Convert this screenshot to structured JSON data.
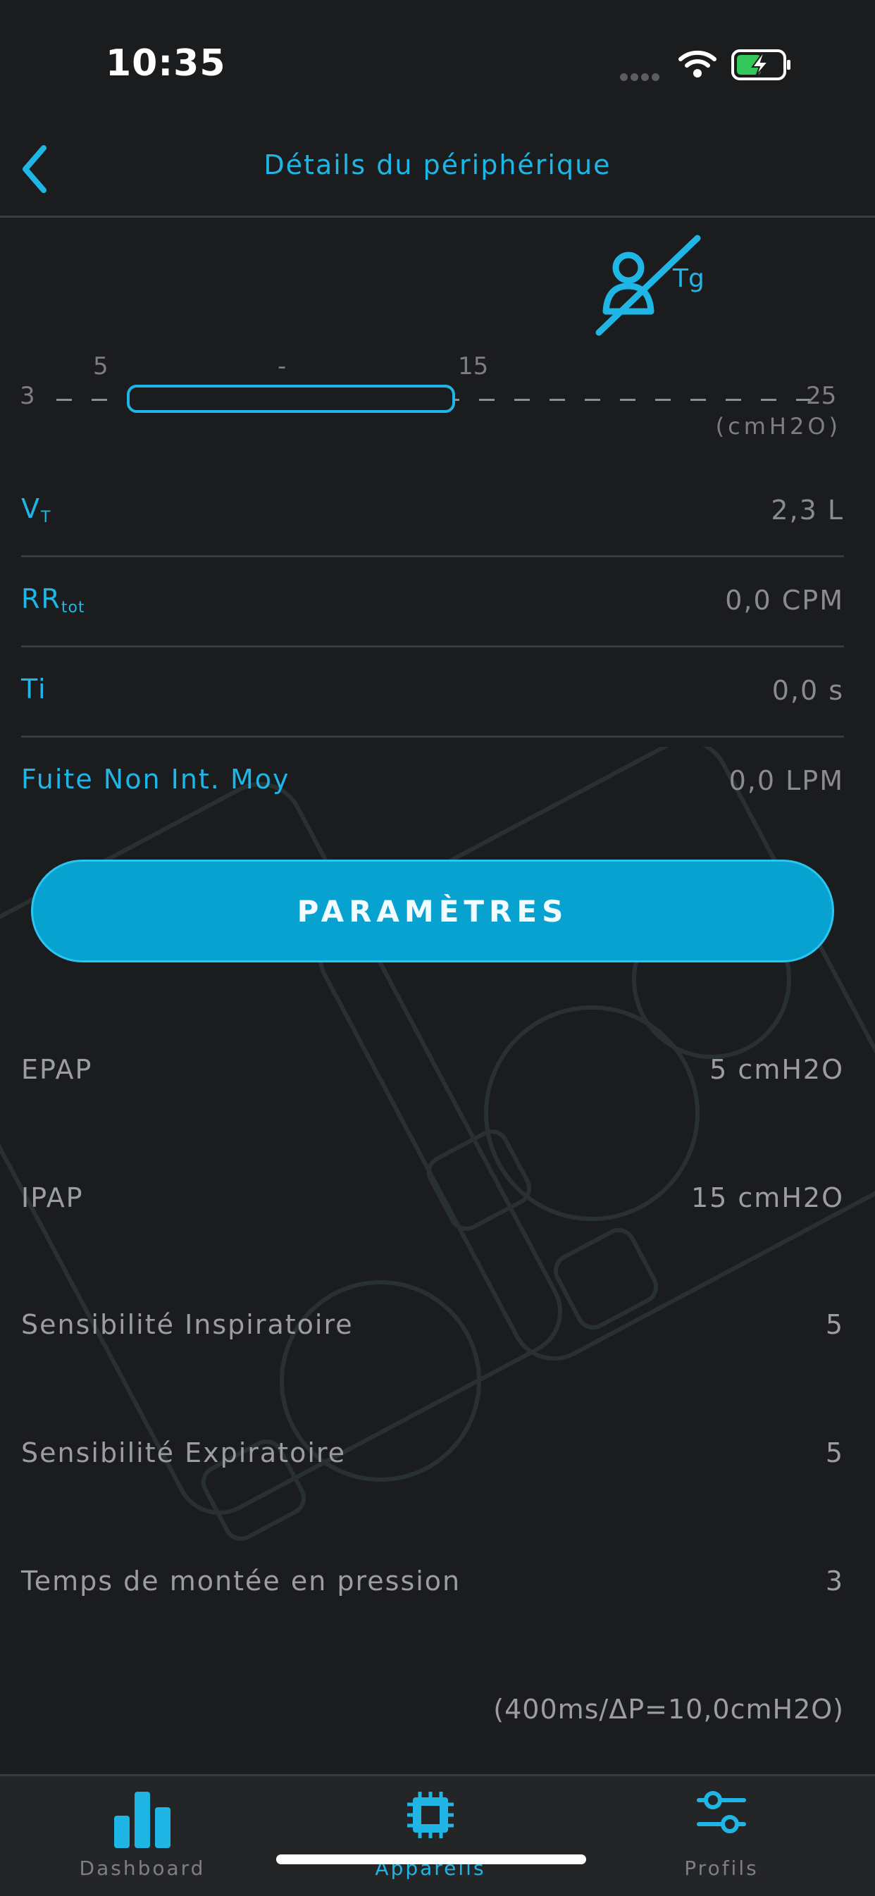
{
  "status_bar": {
    "time": "10:35"
  },
  "nav": {
    "title": "Détails du périphérique",
    "back_icon": "chevron-left-icon"
  },
  "mode_indicator": {
    "icon": "mask-off-icon",
    "label": "Tg"
  },
  "pressure_scale": {
    "min": "3",
    "max": "25",
    "low_label": "5",
    "mid_label": "-",
    "high_label": "15",
    "unit": "(cmH2O)"
  },
  "measurements": [
    {
      "label": "V",
      "sub": "T",
      "value": "2,3 L"
    },
    {
      "label": "RR",
      "sub": "tot",
      "value": "0,0 CPM"
    },
    {
      "label": "Ti",
      "sub": "",
      "value": "0,0 s"
    },
    {
      "label": "Fuite Non Int. Moy",
      "sub": "",
      "value": "0,0 LPM"
    }
  ],
  "params_button": "PARAMÈTRES",
  "settings": [
    {
      "label": "EPAP",
      "value": "5 cmH2O"
    },
    {
      "label": "IPAP",
      "value": "15 cmH2O"
    },
    {
      "label": "Sensibilité Inspiratoire",
      "value": "5"
    },
    {
      "label": "Sensibilité Expiratoire",
      "value": "5"
    },
    {
      "label": "Temps de montée en pression",
      "value": "3"
    }
  ],
  "footnote": "(400ms/ΔP=10,0cmH2O)",
  "tabbar": [
    {
      "label": "Dashboard",
      "icon": "bar-chart-icon"
    },
    {
      "label": "Appareils",
      "icon": "chip-icon"
    },
    {
      "label": "Profils",
      "icon": "sliders-icon"
    }
  ],
  "colors": {
    "accent": "#1fb6e6",
    "button": "#07a2cf",
    "background": "#1b1c1e"
  }
}
